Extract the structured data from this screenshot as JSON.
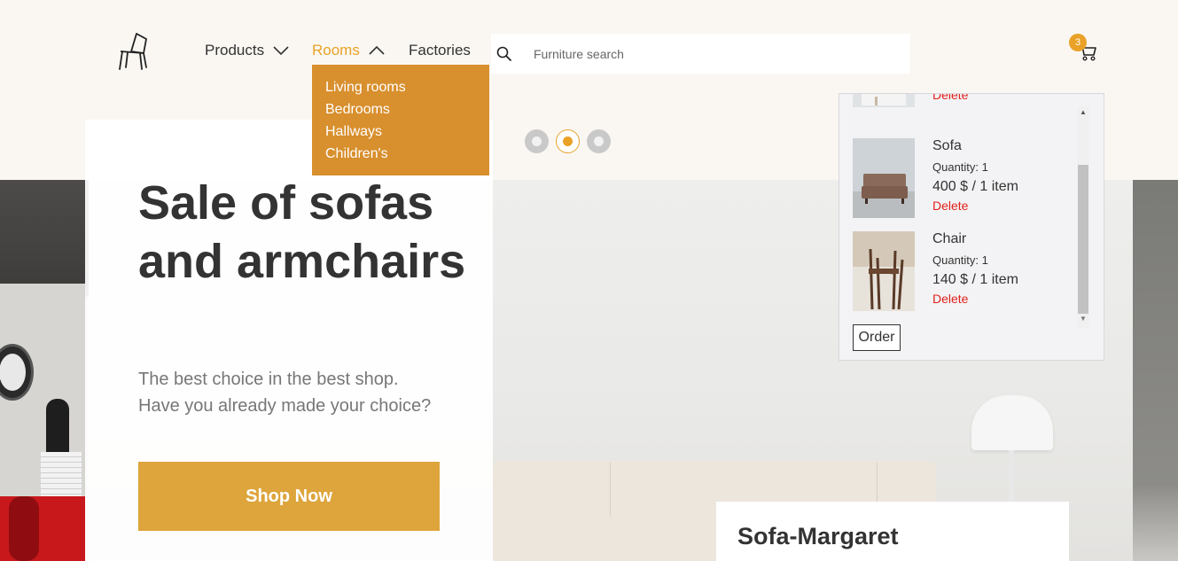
{
  "nav": {
    "products": "Products",
    "rooms": "Rooms",
    "factories": "Factories",
    "rooms_menu": [
      "Living rooms",
      "Bedrooms",
      "Hallways",
      "Children's"
    ]
  },
  "search": {
    "placeholder": "Furniture search"
  },
  "cart": {
    "count": "3",
    "items": [
      {
        "name": "",
        "quantity": "",
        "price": "",
        "delete": "Delete"
      },
      {
        "name": "Sofa",
        "quantity": "Quantity: 1",
        "price": "400 $ / 1 item",
        "delete": "Delete"
      },
      {
        "name": "Chair",
        "quantity": "Quantity: 1",
        "price": "140 $ / 1 item",
        "delete": "Delete"
      }
    ],
    "order_label": "Order"
  },
  "hero": {
    "title": "Sale of sofas and armchairs",
    "subtitle_line1": "The best choice in the best shop.",
    "subtitle_line2": "Have you already made your choice?",
    "cta": "Shop Now"
  },
  "slider": {
    "dots": 3,
    "active_index": 1
  },
  "product": {
    "name": "Sofa-Margaret"
  },
  "colors": {
    "accent": "#e9a227",
    "dropdown": "#d88f2d",
    "cta": "#dda53c",
    "delete": "#e0221b"
  },
  "icons": {
    "logo": "chair-logo-icon",
    "search": "search-icon",
    "cart": "cart-icon",
    "chevron_down": "chevron-down-icon",
    "chevron_up": "chevron-up-icon"
  }
}
